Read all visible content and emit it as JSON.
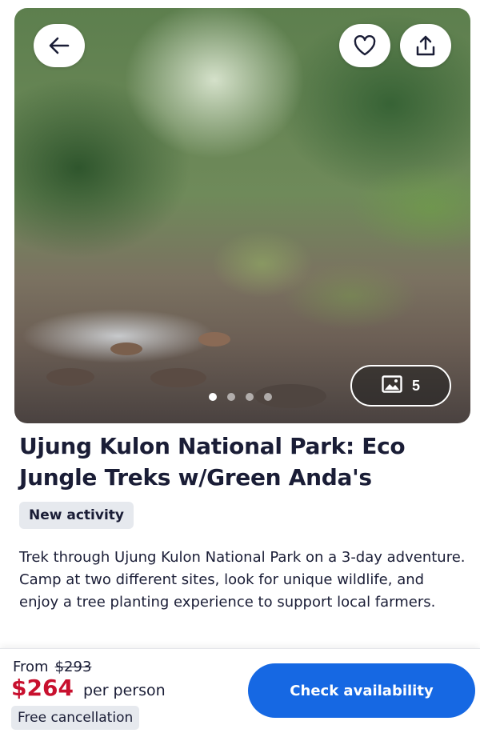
{
  "gallery": {
    "photo_count": "5",
    "dots_total": 4,
    "dots_active_index": 0,
    "icons": {
      "back": "arrow-left-icon",
      "favorite": "heart-icon",
      "share": "share-upload-icon",
      "photos": "image-icon"
    }
  },
  "activity": {
    "title": "Ujung Kulon National Park: Eco Jungle Treks w/Green Anda's",
    "badge": "New activity",
    "description": "Trek through Ujung Kulon National Park on a 3-day adventure. Camp at two different sites, look for unique wildlife, and enjoy a tree planting experience to support local farmers."
  },
  "booking": {
    "from_label": "From",
    "original_price": "$293",
    "price": "$264",
    "per_person": "per person",
    "free_cancellation": "Free cancellation",
    "cta_label": "Check availability"
  },
  "colors": {
    "primary": "#1668e3",
    "price_red": "#c8102e",
    "text_dark": "#1a1d36",
    "badge_bg": "#e6e9ee"
  }
}
